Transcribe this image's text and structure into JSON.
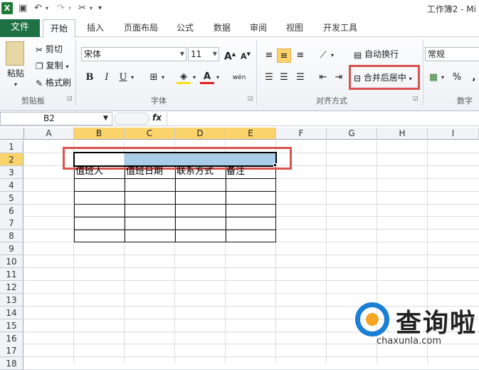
{
  "window": {
    "title": "工作簿2 - Mi"
  },
  "quick_access": {
    "undo_glyph": "↶",
    "redo_glyph": "↷",
    "customize_glyph": "⁐"
  },
  "tabs": [
    {
      "label": "文件"
    },
    {
      "label": "开始"
    },
    {
      "label": "插入"
    },
    {
      "label": "页面布局"
    },
    {
      "label": "公式"
    },
    {
      "label": "数据"
    },
    {
      "label": "审阅"
    },
    {
      "label": "视图"
    },
    {
      "label": "开发工具"
    }
  ],
  "ribbon": {
    "clipboard": {
      "group_label": "剪贴板",
      "paste": "粘贴",
      "cut": "剪切",
      "copy": "复制",
      "format_painter": "格式刷"
    },
    "font": {
      "group_label": "字体",
      "font_name": "宋体",
      "font_size": "11",
      "grow": "A",
      "shrink": "A",
      "bold": "B",
      "italic": "I",
      "underline": "U",
      "font_color": "A",
      "phonetic": "wén"
    },
    "alignment": {
      "group_label": "对齐方式",
      "wrap_text": "自动换行",
      "merge_center": "合并后居中"
    },
    "number": {
      "group_label": "数字",
      "format": "常规",
      "percent": "%",
      "comma": ","
    }
  },
  "formula_bar": {
    "name_box": "B2",
    "fx": "fx",
    "formula": ""
  },
  "columns": [
    "A",
    "B",
    "C",
    "D",
    "E",
    "F",
    "G",
    "H",
    "I"
  ],
  "rows": [
    "1",
    "2",
    "3",
    "4",
    "5",
    "6",
    "7",
    "8",
    "9",
    "10",
    "11",
    "12",
    "13",
    "14",
    "15",
    "16",
    "17",
    "18"
  ],
  "selected": {
    "columns": [
      "B",
      "C",
      "D",
      "E"
    ],
    "row": "2"
  },
  "cells": {
    "B3": "值班人",
    "C3": "值班日期",
    "D3": "联系方式",
    "E3": "备注"
  },
  "watermark": {
    "text": "查询啦",
    "url": "chaxunla.com"
  },
  "colors": {
    "file_tab": "#1e7145",
    "selected_header": "#fbd36c",
    "highlight_box": "#d9534f",
    "selection_fill": "#a9cce8"
  }
}
